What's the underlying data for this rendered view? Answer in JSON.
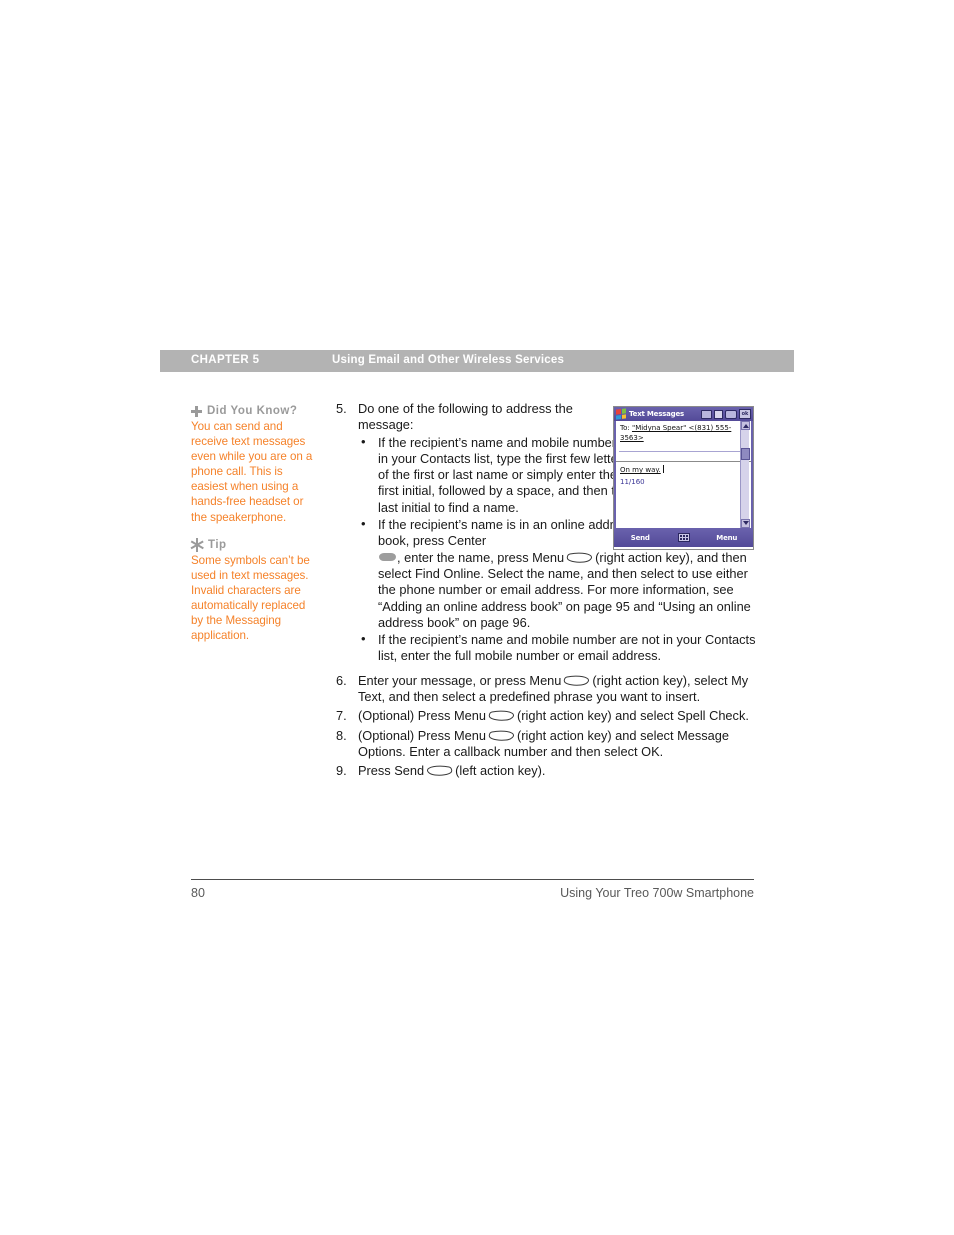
{
  "header": {
    "chapter_label": "CHAPTER 5",
    "chapter_title": "Using Email and Other Wireless Services"
  },
  "sidebar": {
    "notes": [
      {
        "icon": "plus-icon",
        "heading": "Did You Know?",
        "body": "You can send and receive text messages even while you are on a phone call. This is easiest when using a hands-free headset or the speakerphone."
      },
      {
        "icon": "starburst-icon",
        "heading": "Tip",
        "body": "Some symbols can’t be used in text messages. Invalid characters are automatically replaced by the Messaging application."
      }
    ]
  },
  "steps": {
    "step5": {
      "number": "5.",
      "text": "Do one of the following to address the message:",
      "bullets": [
        {
          "dot": "•",
          "text": "If the recipient’s name and mobile number are in your Contacts list, type the first few letters of the first or last name or simply enter the first initial, followed by a space, and then the last initial to find a name."
        },
        {
          "dot": "•",
          "part1": "If the recipient’s name is in an online address book, press Center",
          "part2": ", enter the name, press Menu",
          "part3": "(right action key), and then select Find Online. Select the name, and then select to use either the phone number or email address. For more information, see “Adding an online address book” on page 95 and “Using an online address book” on page 96."
        },
        {
          "dot": "•",
          "text": "If the recipient’s name and mobile number are not in your Contacts list, enter the full mobile number or email address."
        }
      ]
    },
    "step6": {
      "number": "6.",
      "part1": "Enter your message, or press Menu",
      "part2": "(right action key), select My Text, and then select a predefined phrase you want to insert."
    },
    "step7": {
      "number": "7.",
      "part1": "(Optional) Press Menu",
      "part2": "(right action key) and select Spell Check."
    },
    "step8": {
      "number": "8.",
      "part1": "(Optional) Press Menu",
      "part2": "(right action key) and select Message Options. Enter a callback number and then select OK."
    },
    "step9": {
      "number": "9.",
      "part1": "Press Send",
      "part2": "(left action key)."
    }
  },
  "device": {
    "app_title": "Text Messages",
    "status_icons": [
      "battery-icon",
      "signal-icon",
      "speaker-icon",
      "ok-button"
    ],
    "ok_label": "ok",
    "to_label": "To:",
    "recipient": "\"Midyna Spear\" <(831) 555-3563>",
    "message": "On my way.",
    "char_count": "11/160",
    "softkey_left": "Send",
    "softkey_center_icon": "keyboard-icon",
    "softkey_right": "Menu"
  },
  "footer": {
    "page_number": "80",
    "book_title": "Using Your Treo 700w Smartphone"
  },
  "colors": {
    "accent_orange": "#f5822a",
    "header_gray": "#b3b3b3",
    "device_purple": "#5b53a0"
  }
}
